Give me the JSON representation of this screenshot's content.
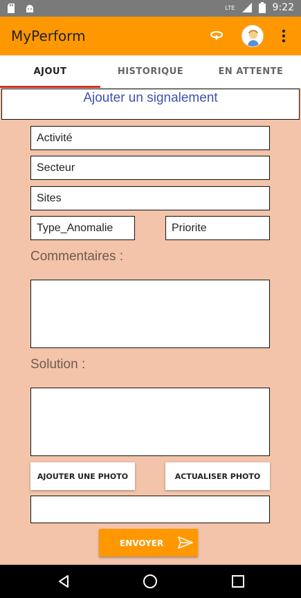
{
  "status_bar": {
    "time": "9:22",
    "network": "LTE",
    "icons": [
      "sd-card-icon",
      "android-icon",
      "signal-icon",
      "battery-icon"
    ]
  },
  "app_bar": {
    "title": "MyPerform",
    "actions": [
      "refresh-icon",
      "avatar",
      "overflow-menu-icon"
    ],
    "color": "#ff9800"
  },
  "tabs": [
    {
      "label": "AJOUT",
      "active": true
    },
    {
      "label": "HISTORIQUE",
      "active": false
    },
    {
      "label": "EN ATTENTE",
      "active": false
    }
  ],
  "form": {
    "title": "Ajouter un signalement",
    "activite": "Activité",
    "secteur": "Secteur",
    "sites": "Sites",
    "type_anomalie": "Type_Anomalie",
    "priorite": "Priorite",
    "commentaires_label": "Commentaires :",
    "commentaires_value": "",
    "solution_label": "Solution :",
    "solution_value": "",
    "photo_path": "",
    "add_photo_label": "AJOUTER UNE PHOTO",
    "refresh_photo_label": "ACTUALISER PHOTO",
    "send_label": "ENVOYER"
  },
  "colors": {
    "background": "#f3c4aa",
    "accent": "#ff9800",
    "tab_indicator": "#d0321e",
    "title_text": "#3f51b5"
  }
}
